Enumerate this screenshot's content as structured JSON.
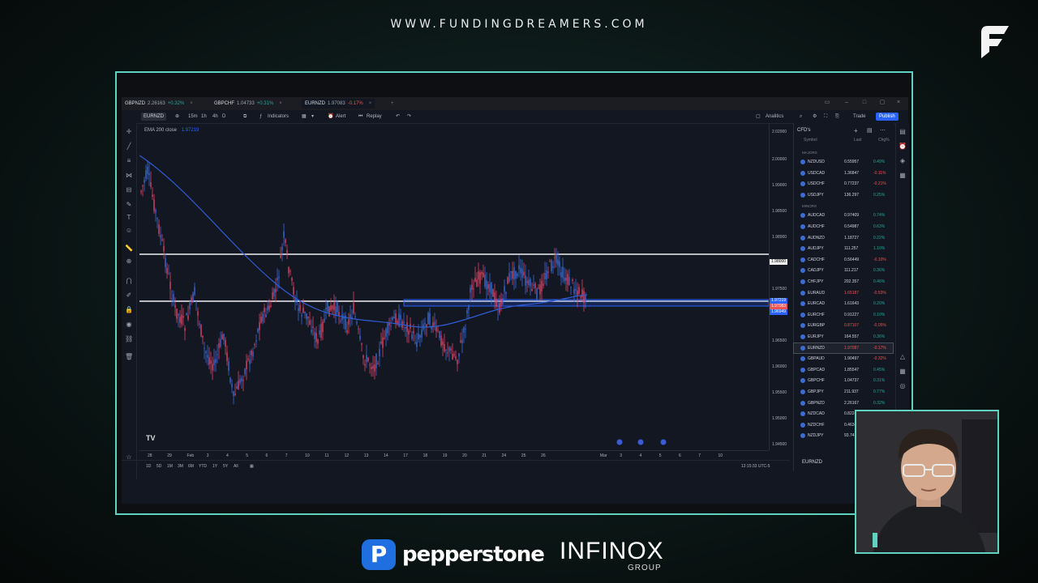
{
  "site_url": "WWW.FUNDINGDREAMERS.COM",
  "browser_tabs": [
    {
      "symbol": "GBPNZD",
      "price": "2.26163",
      "change": "+0.32%",
      "dir": "up"
    },
    {
      "symbol": "GBPCHF",
      "price": "1.04733",
      "change": "+0.31%",
      "dir": "up"
    },
    {
      "symbol": "EURNZD",
      "price": "1.97083",
      "change": "-0.17%",
      "dir": "down"
    }
  ],
  "toolbar": {
    "symbol": "EURNZD",
    "interval_1": "15m",
    "interval_2": "1h",
    "interval_3": "4h",
    "interval_4": "D",
    "indicators": "Indicators",
    "alert": "Alert",
    "replay": "Replay",
    "analytics": "Analitics",
    "trade": "Trade",
    "publish": "Publish"
  },
  "indicator_legend": {
    "name": "EMA 200 close",
    "value": "1.97219"
  },
  "price_axis": [
    "2.00000",
    "1.99000",
    "1.98500",
    "1.98000",
    "1.97500",
    "1.97000",
    "1.96500",
    "1.96000",
    "1.95500",
    "1.95000",
    "1.94500",
    "2.02000"
  ],
  "price_labels": {
    "resistance": "1.98000",
    "ema": "1.97219",
    "current": "1.97083",
    "support": "1.96949"
  },
  "time_axis": [
    "28",
    "29",
    "Feb",
    "3",
    "4",
    "5",
    "6",
    "7",
    "10",
    "11",
    "12",
    "13",
    "14",
    "17",
    "18",
    "19",
    "20",
    "21",
    "24",
    "25",
    "26",
    "Mar",
    "3",
    "4",
    "5",
    "6",
    "7",
    "10"
  ],
  "bottom_bar": {
    "ranges": [
      "1D",
      "5D",
      "1M",
      "3M",
      "6M",
      "YTD",
      "1Y",
      "5Y",
      "All"
    ],
    "clock": "12:15:33 UTC-5"
  },
  "watchlist": {
    "title": "CFD's",
    "columns": [
      "Symbol",
      "Last",
      "Chg%"
    ],
    "groups": [
      {
        "label": "MAJORS",
        "rows": [
          {
            "symbol": "NZDUSD",
            "last": "0.55957",
            "chg": "0.49%",
            "dir": "up"
          },
          {
            "symbol": "USDCAD",
            "last": "1.36847",
            "chg": "-0.11%",
            "dir": "down"
          },
          {
            "symbol": "USDCHF",
            "last": "0.77237",
            "chg": "-0.21%",
            "dir": "down"
          },
          {
            "symbol": "USDJPY",
            "last": "136.297",
            "chg": "0.25%",
            "dir": "up"
          }
        ]
      },
      {
        "label": "MINORS",
        "rows": [
          {
            "symbol": "AUDCAD",
            "last": "0.97409",
            "chg": "0.74%",
            "dir": "up"
          },
          {
            "symbol": "AUDCHF",
            "last": "0.54987",
            "chg": "0.63%",
            "dir": "up"
          },
          {
            "symbol": "AUDNZD",
            "last": "1.18727",
            "chg": "0.22%",
            "dir": "up"
          },
          {
            "symbol": "AUDJPY",
            "last": "111.257",
            "chg": "1.10%",
            "dir": "up"
          },
          {
            "symbol": "CADCHF",
            "last": "0.56449",
            "chg": "-0.10%",
            "dir": "down"
          },
          {
            "symbol": "CADJPY",
            "last": "111.217",
            "chg": "0.36%",
            "dir": "up"
          },
          {
            "symbol": "CHFJPY",
            "last": "202.357",
            "chg": "0.46%",
            "dir": "up"
          },
          {
            "symbol": "EURAUD",
            "last": "1.65187",
            "chg": "-0.53%",
            "dir": "down"
          },
          {
            "symbol": "EURCAD",
            "last": "1.61643",
            "chg": "0.20%",
            "dir": "up"
          },
          {
            "symbol": "EURCHF",
            "last": "0.91227",
            "chg": "0.10%",
            "dir": "up"
          },
          {
            "symbol": "EURGBP",
            "last": "0.87107",
            "chg": "-0.05%",
            "dir": "down"
          },
          {
            "symbol": "EURJPY",
            "last": "164.557",
            "chg": "0.36%",
            "dir": "up"
          },
          {
            "symbol": "EURNZD",
            "last": "1.97087",
            "chg": "-0.17%",
            "dir": "down",
            "selected": true
          },
          {
            "symbol": "GBPAUD",
            "last": "1.90497",
            "chg": "-0.32%",
            "dir": "down"
          },
          {
            "symbol": "GBPCAD",
            "last": "1.85547",
            "chg": "0.45%",
            "dir": "up"
          },
          {
            "symbol": "GBPCHF",
            "last": "1.04737",
            "chg": "0.31%",
            "dir": "up"
          },
          {
            "symbol": "GBPJPY",
            "last": "211.937",
            "chg": "0.77%",
            "dir": "up"
          },
          {
            "symbol": "GBPNZD",
            "last": "2.26167",
            "chg": "0.32%",
            "dir": "up"
          },
          {
            "symbol": "NZDCAD",
            "last": "0.82247",
            "chg": "0.43%",
            "dir": "up"
          },
          {
            "symbol": "NZDCHF",
            "last": "0.46347",
            "chg": "0.30%",
            "dir": "up"
          },
          {
            "symbol": "NZDJPY",
            "last": "93.747",
            "chg": "0.80%",
            "dir": "up"
          }
        ]
      }
    ],
    "footer_symbol": "EURNZD"
  },
  "sponsors": {
    "pepperstone": "pepperstone",
    "pepperstone_mark": "P",
    "infinox": "INFINOX",
    "infinox_sub": "GROUP"
  },
  "colors": {
    "frame_accent": "#5fd3bf",
    "candle_up": "#3b6cd6",
    "candle_down": "#e04466",
    "ema": "#2f5bd3",
    "zone": "#2962ff"
  }
}
